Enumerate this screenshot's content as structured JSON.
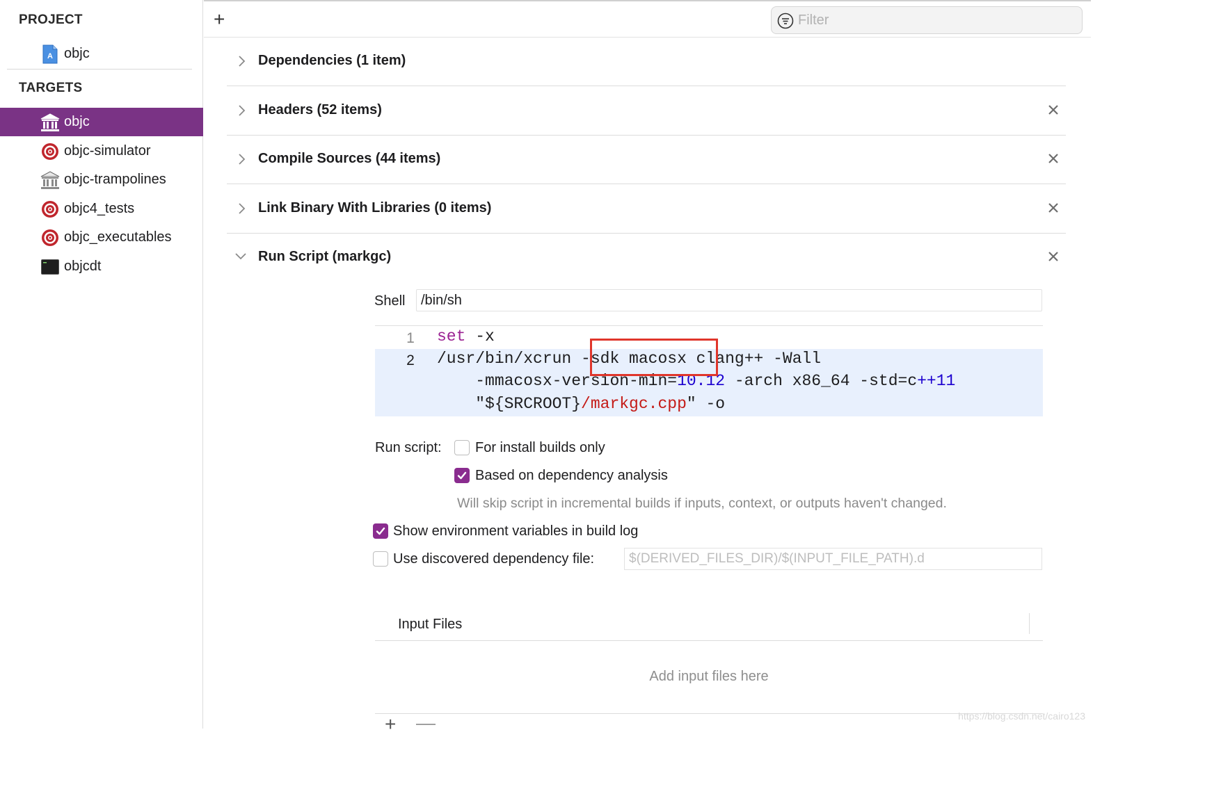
{
  "sidebar": {
    "project_heading": "PROJECT",
    "project_item": {
      "label": "objc",
      "icon": "xcode-project-icon"
    },
    "targets_heading": "TARGETS",
    "targets": [
      {
        "label": "objc",
        "icon": "framework-icon",
        "selected": true
      },
      {
        "label": "objc-simulator",
        "icon": "target-icon",
        "selected": false
      },
      {
        "label": "objc-trampolines",
        "icon": "framework-icon",
        "selected": false
      },
      {
        "label": "objc4_tests",
        "icon": "target-icon",
        "selected": false
      },
      {
        "label": "objc_executables",
        "icon": "target-icon",
        "selected": false
      },
      {
        "label": "objcdt",
        "icon": "terminal-icon",
        "selected": false
      }
    ],
    "selection_color": "#7a3385"
  },
  "toolbar": {
    "add_label": "+",
    "filter_placeholder": "Filter"
  },
  "phases": [
    {
      "title": "Dependencies (1 item)",
      "expanded": false,
      "closable": false
    },
    {
      "title": "Headers (52 items)",
      "expanded": false,
      "closable": true
    },
    {
      "title": "Compile Sources (44 items)",
      "expanded": false,
      "closable": true
    },
    {
      "title": "Link Binary With Libraries (0 items)",
      "expanded": false,
      "closable": true
    },
    {
      "title": "Run Script (markgc)",
      "expanded": true,
      "closable": true
    }
  ],
  "run_script": {
    "shell_label": "Shell",
    "shell_value": "/bin/sh",
    "code": {
      "line_numbers": [
        "1",
        "2"
      ],
      "line1_keyword": "set",
      "line1_rest": " -x",
      "line2_a": "/usr/bin/xcrun ",
      "line2_b": "-sdk macosx",
      "line2_c": " clang++ -Wall",
      "line3_a": "    -mmacosx-version-min=",
      "line3_num": "10.12",
      "line3_b": " -arch x86_64 -std=c",
      "line3_num2": "++11",
      "line4_a": "    \"${SRCROOT}",
      "line4_path": "/markgc.cpp",
      "line4_b": "\" -o"
    },
    "run_script_label": "Run script:",
    "install_builds_label": "For install builds only",
    "install_builds_checked": false,
    "dependency_analysis_label": "Based on dependency analysis",
    "dependency_analysis_checked": true,
    "dependency_hint": "Will skip script in incremental builds if inputs, context, or outputs haven't changed.",
    "show_env_label": "Show environment variables in build log",
    "show_env_checked": true,
    "discovered_dep_label": "Use discovered dependency file:",
    "discovered_dep_checked": false,
    "discovered_dep_placeholder": "$(DERIVED_FILES_DIR)/$(INPUT_FILE_PATH).d",
    "input_files_title": "Input Files",
    "input_files_empty": "Add input files here",
    "add_button": "+",
    "remove_button": "—"
  },
  "colors": {
    "accent": "#8a2c8f",
    "annotation_box": "#e0362b",
    "keyword": "#9b2393",
    "number": "#1c00cf",
    "string_path": "#c41a16"
  },
  "watermark": "https://blog.csdn.net/cairo123"
}
